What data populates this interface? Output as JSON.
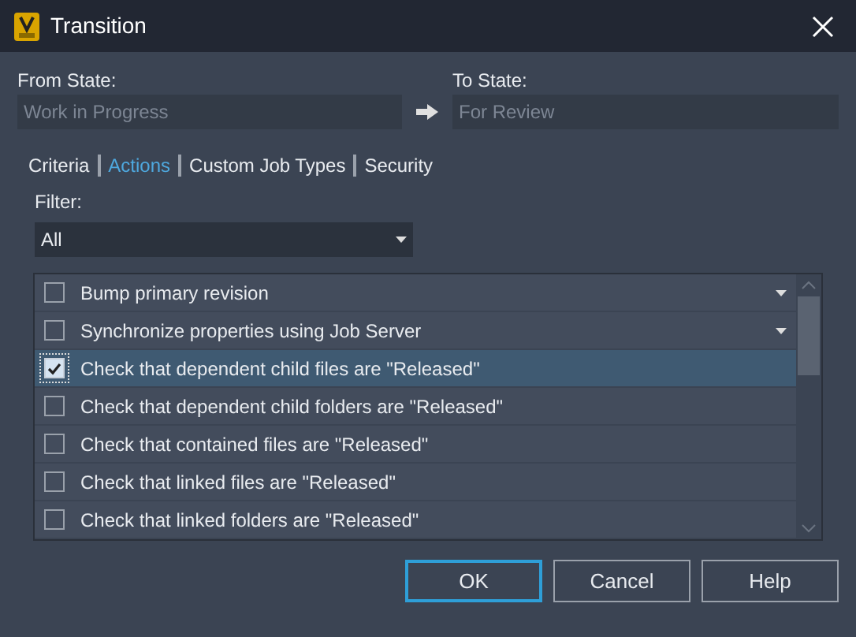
{
  "window": {
    "title": "Transition"
  },
  "from_state": {
    "label": "From State:",
    "value": "Work in Progress"
  },
  "to_state": {
    "label": "To State:",
    "value": "For Review"
  },
  "tabs": [
    {
      "label": "Criteria",
      "selected": false
    },
    {
      "label": "Actions",
      "selected": true
    },
    {
      "label": "Custom Job Types",
      "selected": false
    },
    {
      "label": "Security",
      "selected": false
    }
  ],
  "filter": {
    "label": "Filter:",
    "value": "All"
  },
  "actions": [
    {
      "label": "Bump primary revision",
      "kind": "dropdown",
      "checked": false,
      "selected": false
    },
    {
      "label": "Synchronize properties using Job Server",
      "kind": "dropdown",
      "checked": false,
      "selected": false
    },
    {
      "label": "Check that dependent child files are \"Released\"",
      "kind": "check",
      "checked": true,
      "selected": true
    },
    {
      "label": "Check that dependent child folders are \"Released\"",
      "kind": "check",
      "checked": false,
      "selected": false
    },
    {
      "label": "Check that contained files are \"Released\"",
      "kind": "check",
      "checked": false,
      "selected": false
    },
    {
      "label": "Check that linked files are \"Released\"",
      "kind": "check",
      "checked": false,
      "selected": false
    },
    {
      "label": "Check that linked folders are \"Released\"",
      "kind": "check",
      "checked": false,
      "selected": false
    }
  ],
  "buttons": [
    {
      "label": "OK",
      "default": true
    },
    {
      "label": "Cancel",
      "default": false
    },
    {
      "label": "Help",
      "default": false
    }
  ]
}
